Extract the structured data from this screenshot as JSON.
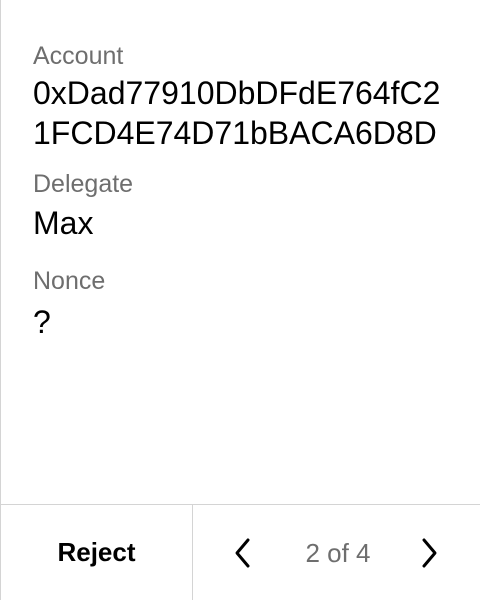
{
  "fields": {
    "account": {
      "label": "Account",
      "value": "0xDad77910DbDFdE764fC21FCD4E74D71bBACA6D8D"
    },
    "delegate": {
      "label": "Delegate",
      "value": "Max"
    },
    "nonce": {
      "label": "Nonce",
      "value": "?"
    }
  },
  "footer": {
    "reject_label": "Reject",
    "page_indicator": "2 of 4",
    "prev_icon": "chevron-left-icon",
    "next_icon": "chevron-right-icon"
  },
  "colors": {
    "label_text": "#6e6e6e",
    "value_text": "#000000",
    "divider": "#d4d4d4",
    "background": "#ffffff"
  }
}
